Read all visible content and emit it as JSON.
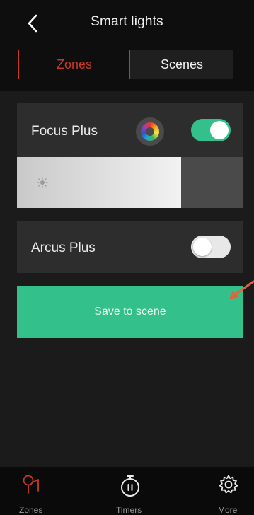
{
  "header": {
    "title": "Smart lights"
  },
  "tabs": [
    {
      "label": "Zones",
      "active": true
    },
    {
      "label": "Scenes",
      "active": false
    }
  ],
  "lights": [
    {
      "name": "Focus Plus",
      "on": true,
      "has_color_wheel": true,
      "brightness_fraction": 0.725
    },
    {
      "name": "Arcus Plus",
      "on": false,
      "has_color_wheel": false
    }
  ],
  "actions": {
    "save_label": "Save to scene"
  },
  "nav": [
    {
      "label": "Zones",
      "icon": "zones-icon",
      "active": true
    },
    {
      "label": "Timers",
      "icon": "timer-icon",
      "active": false
    },
    {
      "label": "More",
      "icon": "gear-icon",
      "active": false
    }
  ],
  "colors": {
    "accent_red": "#c83a27",
    "toggle_green": "#34c08a",
    "background": "#1b1b1b",
    "card": "#2d2d2d",
    "annotation_arrow": "#e0643f"
  }
}
